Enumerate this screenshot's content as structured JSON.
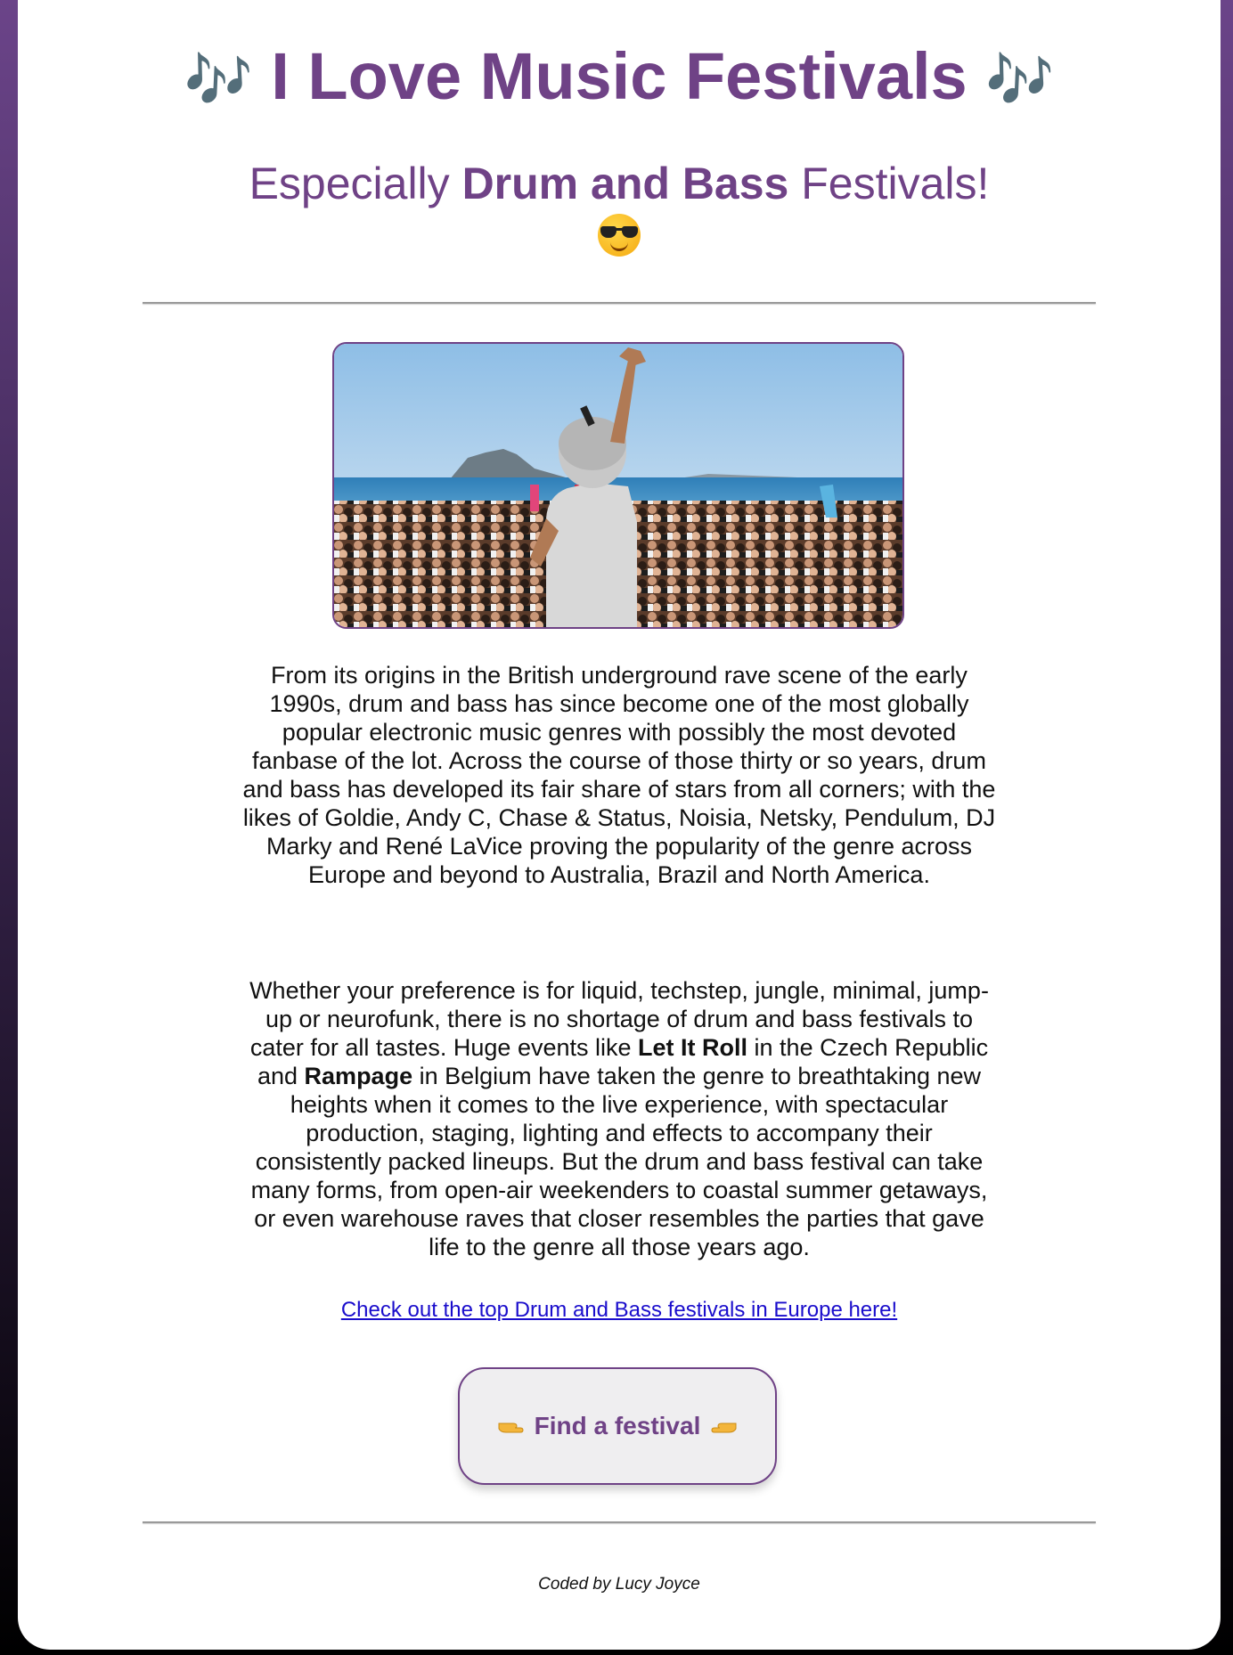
{
  "header": {
    "note_left": "🎶",
    "title": "I Love Music Festivals",
    "note_right": "🎶"
  },
  "subtitle": {
    "prefix": "Especially",
    "bold": "Drum and Bass",
    "suffix": "Festivals!"
  },
  "hero_image": {
    "description_icon": "festival-crowd-image"
  },
  "paragraph1": "From its origins in the British underground rave scene of the early 1990s, drum and bass has since become one of the most globally popular electronic music genres with possibly the most devoted fanbase of the lot. Across the course of those thirty or so years, drum and bass has developed its fair share of stars from all corners; with the likes of Goldie, Andy C, Chase & Status, Noisia, Netsky, Pendulum, DJ Marky and René LaVice proving the popularity of the genre across Europe and beyond to Australia, Brazil and North America.",
  "paragraph2": {
    "part1": "Whether your preference is for liquid, techstep, jungle, minimal, jump-up or neurofunk, there is no shortage of drum and bass festivals to cater for all tastes. Huge events like ",
    "bold1": "Let It Roll",
    "part2": " in the Czech Republic and ",
    "bold2": "Rampage",
    "part3": " in Belgium have taken the genre to breathtaking new heights when it comes to the live experience, with spectacular production, staging, lighting and effects to accompany their consistently packed lineups. But the drum and bass festival can take many forms, from open-air weekenders to coastal summer getaways, or even warehouse raves that closer resembles the parties that gave life to the genre all those years ago."
  },
  "link": {
    "text": "Check out the top Drum and Bass festivals in Europe here!"
  },
  "button": {
    "label": "Find a festival"
  },
  "footer": {
    "credit": "Coded by Lucy Joyce"
  },
  "colors": {
    "accent": "#6f4286",
    "link": "#1a0dcc"
  }
}
